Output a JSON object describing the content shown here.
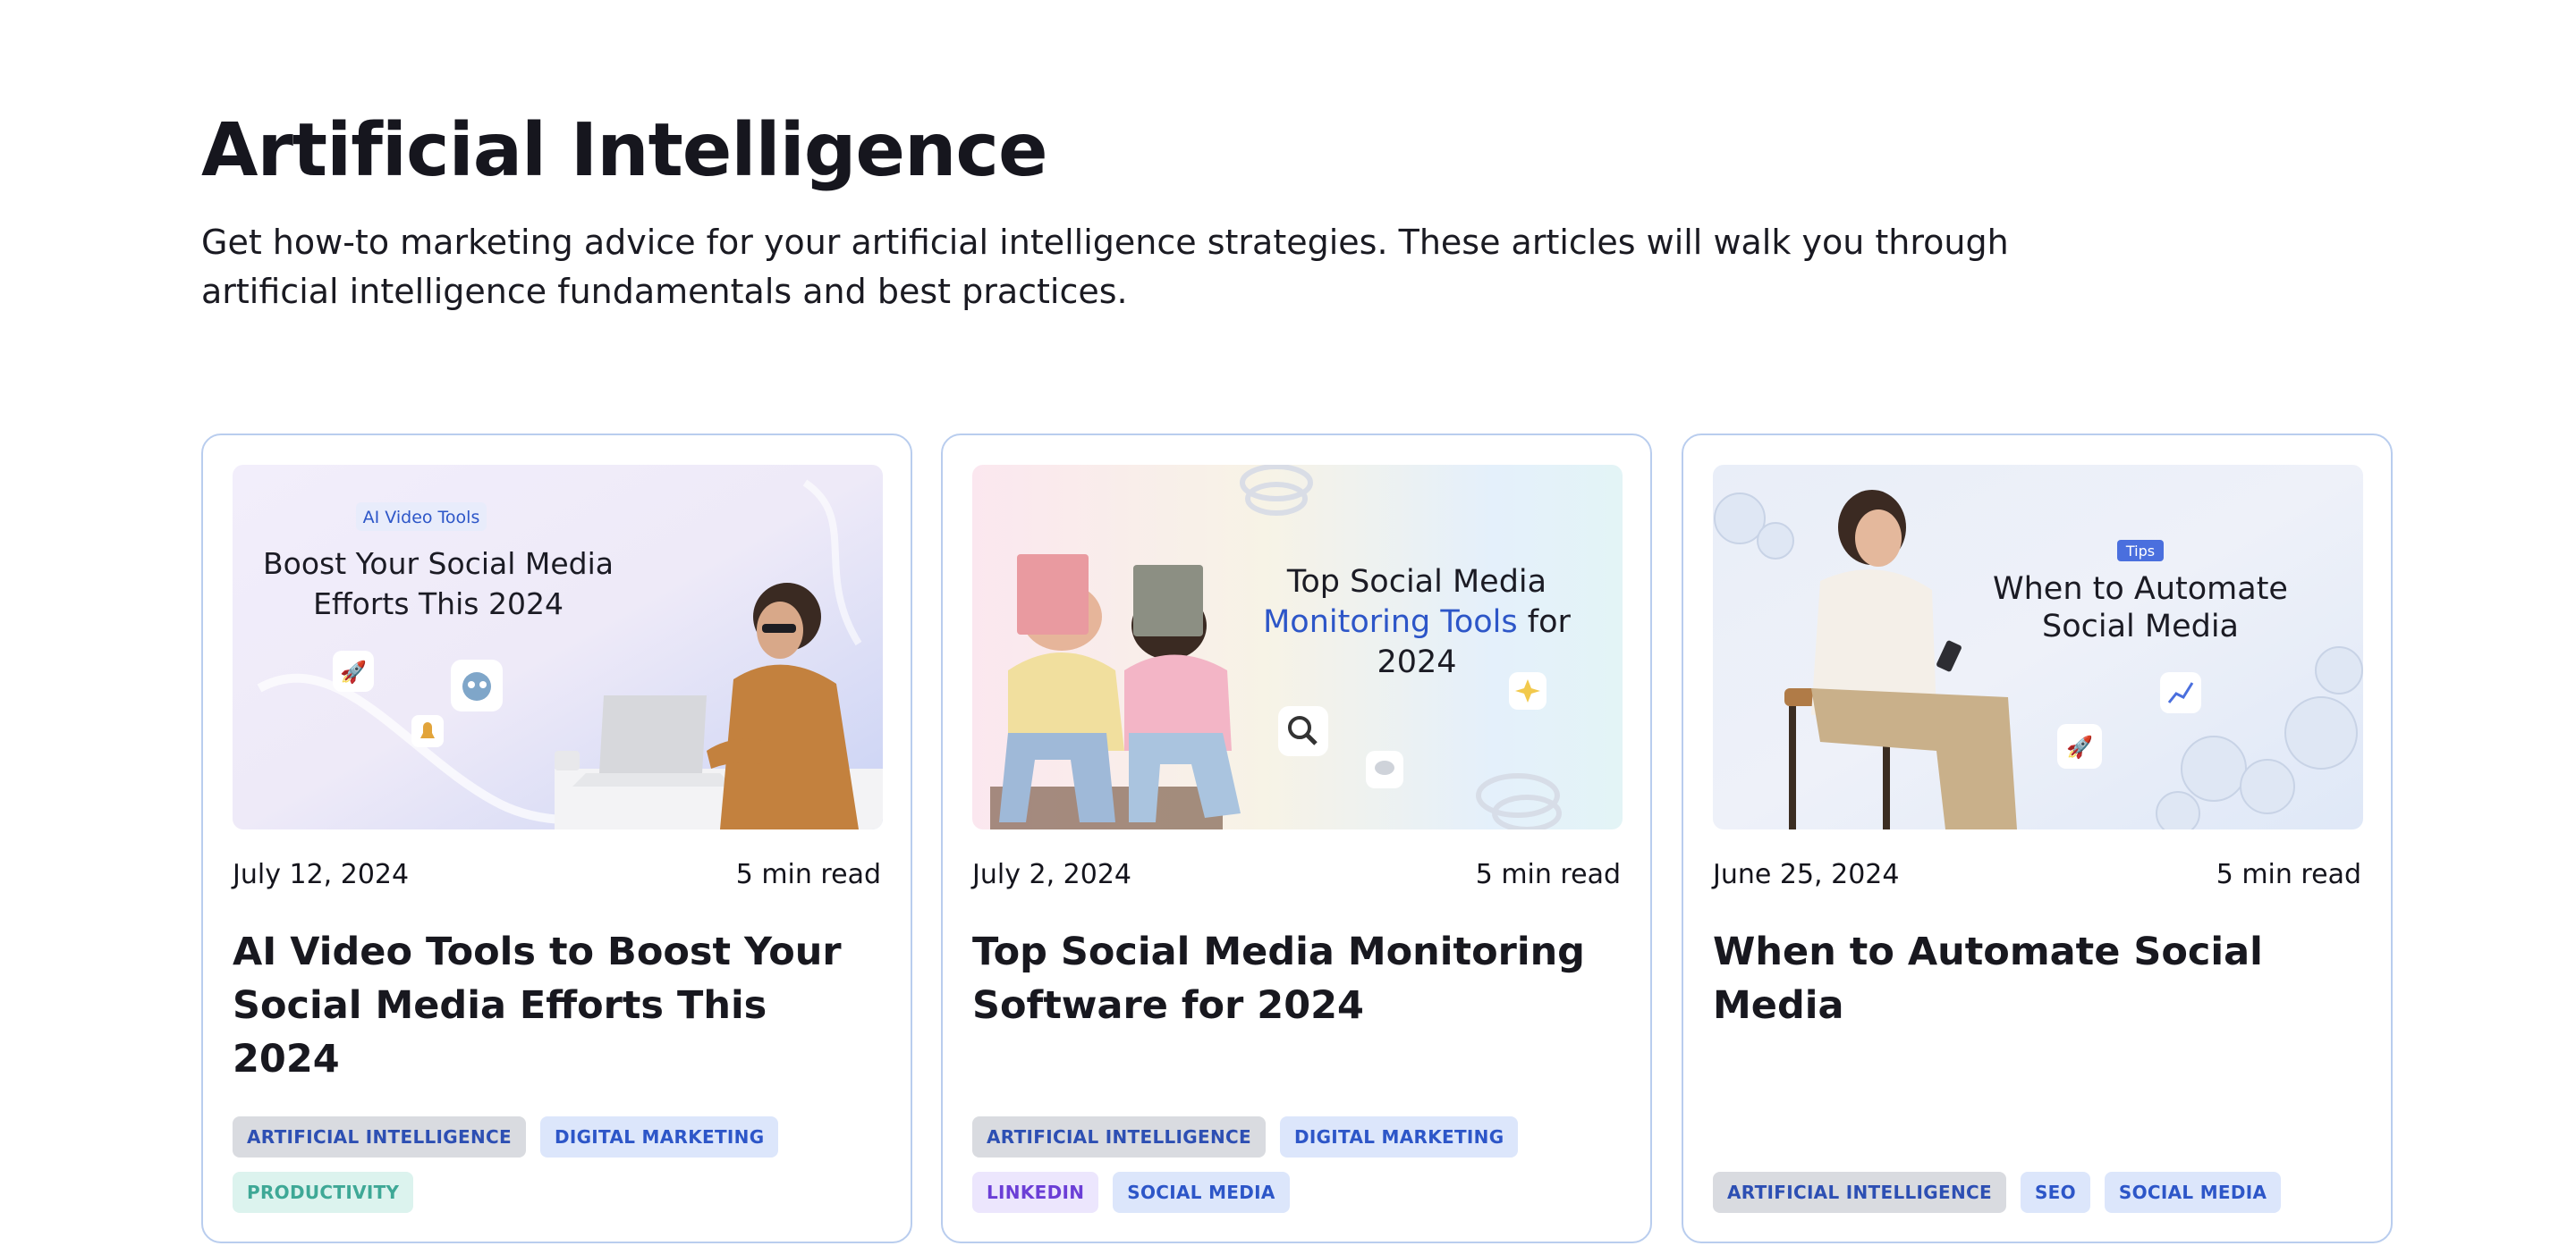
{
  "header": {
    "title": "Artificial Intelligence",
    "description": "Get how-to marketing advice for your artificial intelligence strategies. These articles will walk you through artificial intelligence fundamentals and best practices."
  },
  "cards": [
    {
      "image": {
        "badge": "AI Video Tools",
        "line1": "Boost Your Social Media",
        "line2": "Efforts This 2024"
      },
      "date": "July 12, 2024",
      "read_time": "5 min read",
      "title": "AI Video Tools to Boost Your Social Media Efforts This 2024",
      "tags": [
        "ARTIFICIAL INTELLIGENCE",
        "DIGITAL MARKETING",
        "PRODUCTIVITY"
      ]
    },
    {
      "image": {
        "line1": "Top Social Media",
        "line2_accent": "Monitoring Tools",
        "line2_rest": " for",
        "line3": "2024"
      },
      "date": "July 2, 2024",
      "read_time": "5 min read",
      "title": "Top Social Media Monitoring Software for 2024",
      "tags": [
        "ARTIFICIAL INTELLIGENCE",
        "DIGITAL MARKETING",
        "LINKEDIN",
        "SOCIAL MEDIA"
      ]
    },
    {
      "image": {
        "badge": "Tips",
        "line1": "When to Automate",
        "line2": "Social Media"
      },
      "date": "June 25, 2024",
      "read_time": "5 min read",
      "title": "When to Automate Social Media",
      "tags": [
        "ARTIFICIAL INTELLIGENCE",
        "SEO",
        "SOCIAL MEDIA"
      ]
    }
  ],
  "colors": {
    "accent_blue": "#2d56c8",
    "card_border": "#b9cdee",
    "tag_ai_bg": "#d9dbe0",
    "tag_blue_bg": "#dce6fb",
    "tag_productivity_bg": "#dcf3ee",
    "tag_linkedin_bg": "#ece6fd"
  },
  "icons": [
    "rocket-icon",
    "robot-icon",
    "magnifier-icon",
    "chat-bubble-icon",
    "sparkle-icon",
    "chart-icon"
  ]
}
